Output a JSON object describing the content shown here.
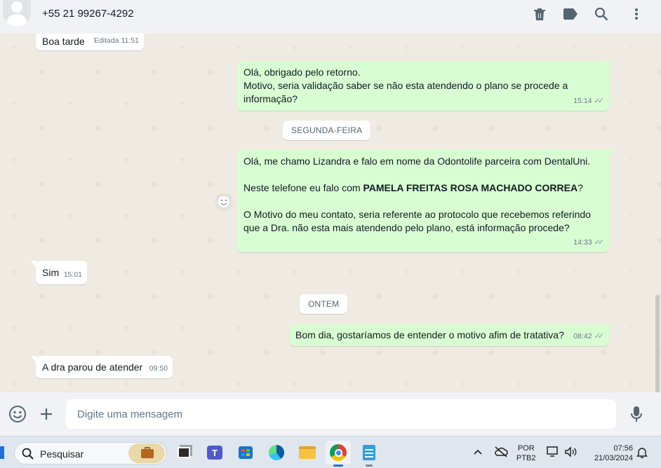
{
  "header": {
    "contact": "+55 21 99267-4292",
    "icons": [
      "delete-icon",
      "label-icon",
      "search-icon",
      "menu-icon"
    ]
  },
  "messages": [
    {
      "dir": "in",
      "text": "Boa tarde",
      "meta": "Editada 11:51"
    },
    {
      "dir": "out",
      "text": "Olá, obrigado pelo retorno.\nMotivo, seria validação saber se não esta atendendo o plano se procede a informação?",
      "time": "15:14"
    },
    {
      "dir": "system",
      "text": "SEGUNDA-FEIRA"
    },
    {
      "dir": "out",
      "text_1": "Olá, me chamo Lizandra e falo em nome da Odontolife parceira com DentalUni.",
      "text_2a": "Neste telefone eu falo com ",
      "text_2b": "PAMELA FREITAS ROSA MACHADO CORREA",
      "text_2c": "?",
      "text_3": "O Motivo do meu contato, seria referente ao protocolo que recebemos referindo que a Dra. não esta mais atendendo pelo plano, está informação procede?",
      "time": "14:33"
    },
    {
      "dir": "in",
      "text": "Sim",
      "time": "15:01"
    },
    {
      "dir": "system",
      "text": "ONTEM"
    },
    {
      "dir": "out",
      "text": "Bom dia, gostaríamos de entender o motivo afim de tratativa?",
      "time": "08:42"
    },
    {
      "dir": "in",
      "text": "A dra parou de atender",
      "time": "09:50"
    }
  ],
  "composer": {
    "placeholder": "Digite uma mensagem",
    "icons": [
      "emoji-icon",
      "plus-icon",
      "microphone-icon"
    ]
  },
  "taskbar": {
    "search_label": "Pesquisar",
    "lang_line1": "POR",
    "lang_line2": "PTB2",
    "clock_time": "07:56",
    "clock_date": "21/03/2024",
    "colors": {
      "whatsapp_out": "#d9fdd3",
      "whatsapp_in": "#ffffff",
      "chat_bg": "#efeae2"
    }
  }
}
